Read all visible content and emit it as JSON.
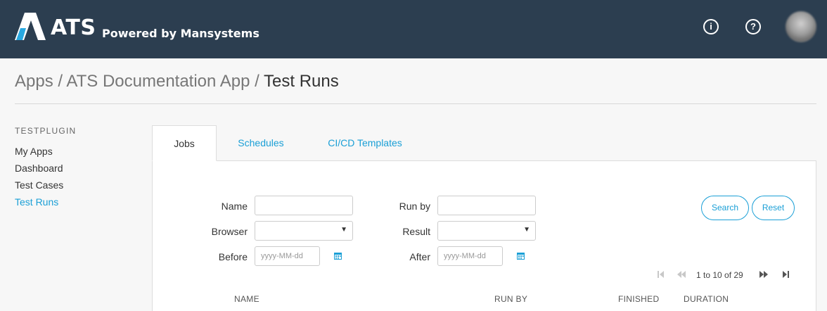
{
  "header": {
    "brand": "ATS",
    "tagline": "Powered by Mansystems",
    "info_icon": "info-circle-icon",
    "help_icon": "question-circle-icon",
    "info_glyph": "i",
    "help_glyph": "?",
    "bg_color": "#2c3e50"
  },
  "breadcrumb": {
    "items": [
      "Apps",
      "ATS Documentation App",
      "Test Runs"
    ],
    "separator": "/"
  },
  "sidebar": {
    "section_title": "TESTPLUGIN",
    "items": [
      {
        "label": "My Apps"
      },
      {
        "label": "Dashboard"
      },
      {
        "label": "Test Cases"
      },
      {
        "label": "Test Runs",
        "active": true
      }
    ]
  },
  "tabs": [
    {
      "label": "Jobs",
      "active": true
    },
    {
      "label": "Schedules"
    },
    {
      "label": "CI/CD Templates"
    }
  ],
  "filters": {
    "name_label": "Name",
    "name_value": "",
    "run_by_label": "Run by",
    "run_by_value": "",
    "browser_label": "Browser",
    "browser_value": "",
    "result_label": "Result",
    "result_value": "",
    "before_label": "Before",
    "before_placeholder": "yyyy-MM-dd",
    "after_label": "After",
    "after_placeholder": "yyyy-MM-dd",
    "search_button": "Search",
    "reset_button": "Reset"
  },
  "pagination": {
    "text": "1 to 10 of 29"
  },
  "table": {
    "columns": [
      "NAME",
      "RUN BY",
      "FINISHED",
      "DURATION"
    ]
  },
  "colors": {
    "accent": "#1a9fd6",
    "logo_blue": "#29a8e0"
  }
}
